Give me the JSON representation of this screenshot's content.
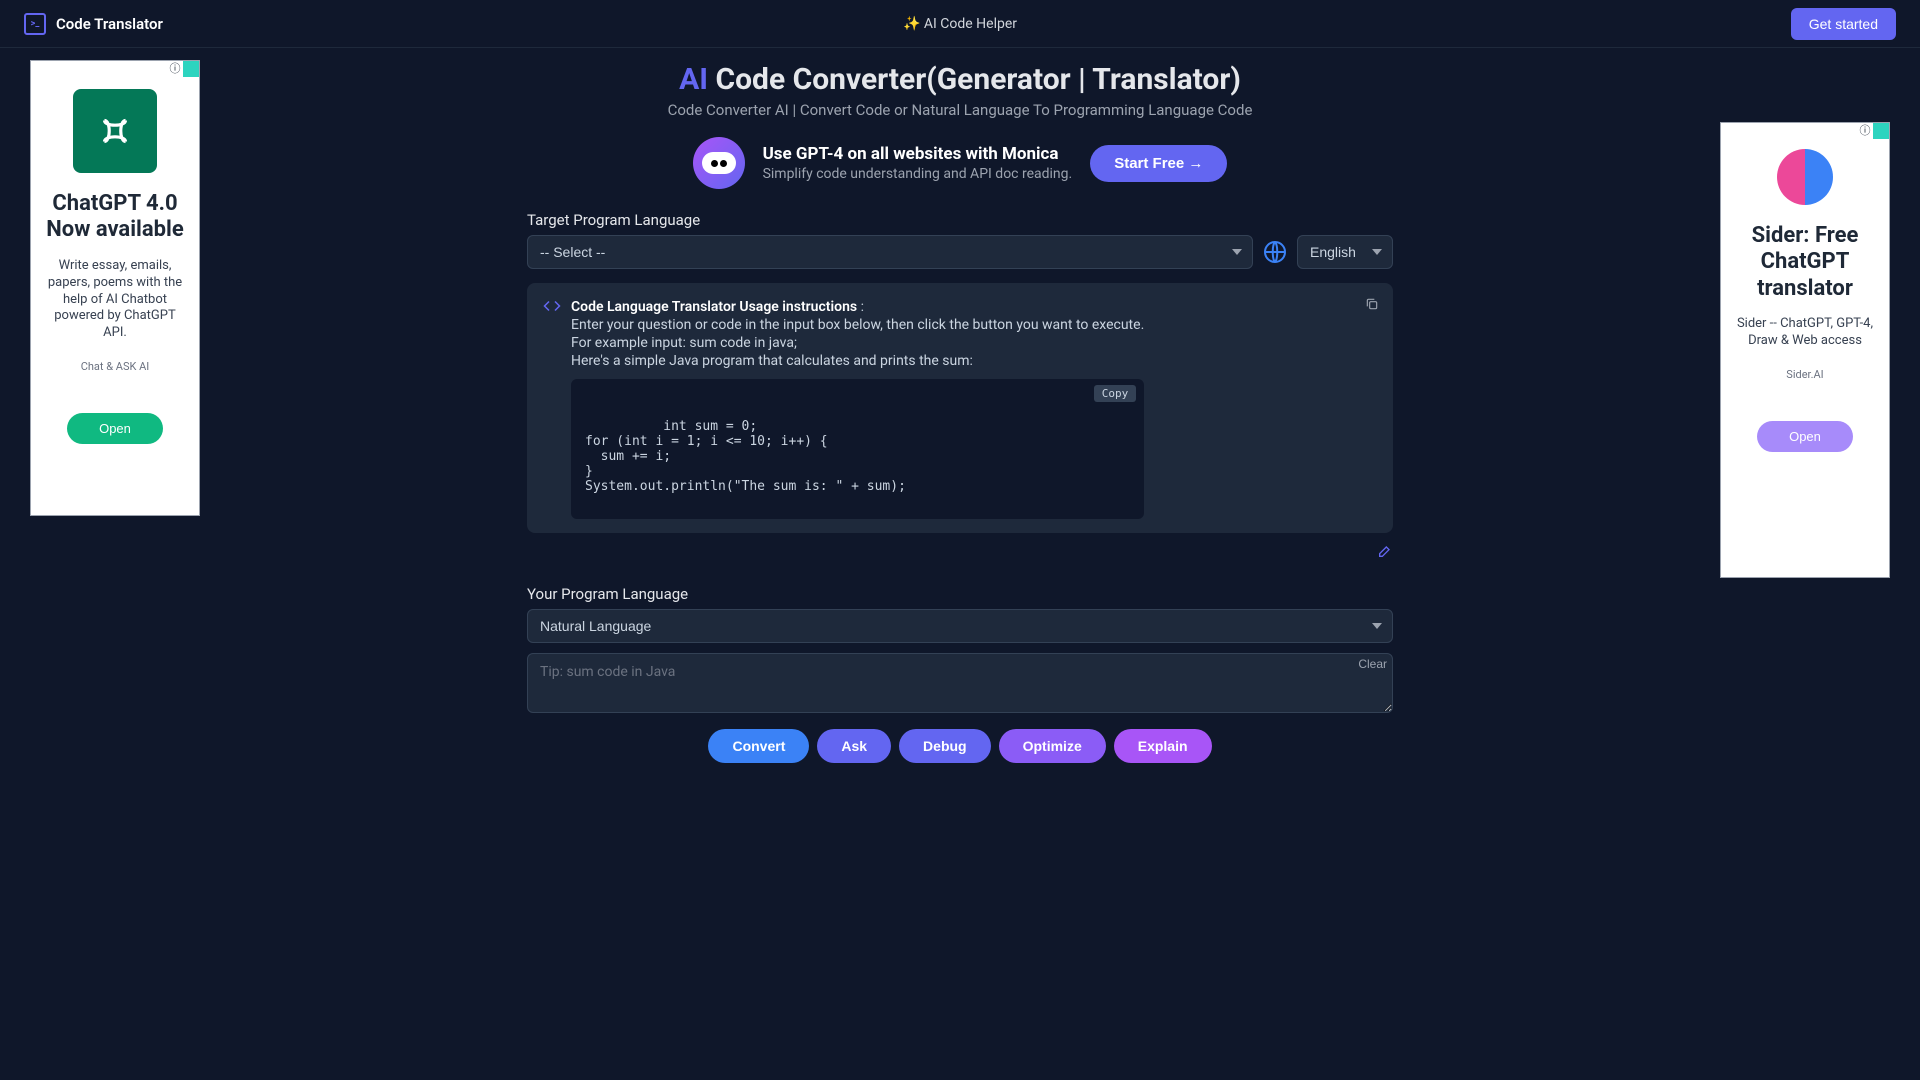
{
  "header": {
    "brand": "Code Translator",
    "center": "✨ AI Code Helper",
    "get_started": "Get started"
  },
  "hero": {
    "title_prefix": "AI",
    "title_rest": " Code Converter(Generator | Translator)",
    "subtitle": "Code Converter AI | Convert Code or Natural Language To Programming Language Code"
  },
  "promo": {
    "title": "Use GPT-4 on all websites with Monica",
    "subtitle": "Simplify code understanding and API doc reading.",
    "button": "Start Free →"
  },
  "target": {
    "label": "Target Program Language",
    "select_placeholder": "-- Select --",
    "lang_select": "English"
  },
  "instructions": {
    "heading": "Code Language Translator Usage instructions",
    "colon": " :",
    "line1": "Enter your question or code in the input box below, then click the button you want to execute.",
    "line2": "For example input: sum code in java;",
    "line3": "Here's a simple Java program that calculates and prints the sum:",
    "code": "int sum = 0;\nfor (int i = 1; i <= 10; i++) {\n  sum += i;\n}\nSystem.out.println(\"The sum is: \" + sum);",
    "copy_label": "Copy"
  },
  "input": {
    "label": "Your Program Language",
    "select_value": "Natural Language",
    "placeholder": "Tip: sum code in Java",
    "clear": "Clear"
  },
  "actions": {
    "convert": "Convert",
    "ask": "Ask",
    "debug": "Debug",
    "optimize": "Optimize",
    "explain": "Explain"
  },
  "ad_left": {
    "title": "ChatGPT 4.0 Now available",
    "desc": "Write essay, emails, papers, poems with the help of AI Chatbot powered by ChatGPT API.",
    "sub": "Chat & ASK AI",
    "button": "Open"
  },
  "ad_right": {
    "title": "Sider: Free ChatGPT translator",
    "desc": "Sider -- ChatGPT, GPT-4, Draw & Web access",
    "sub": "Sider.AI",
    "button": "Open"
  }
}
